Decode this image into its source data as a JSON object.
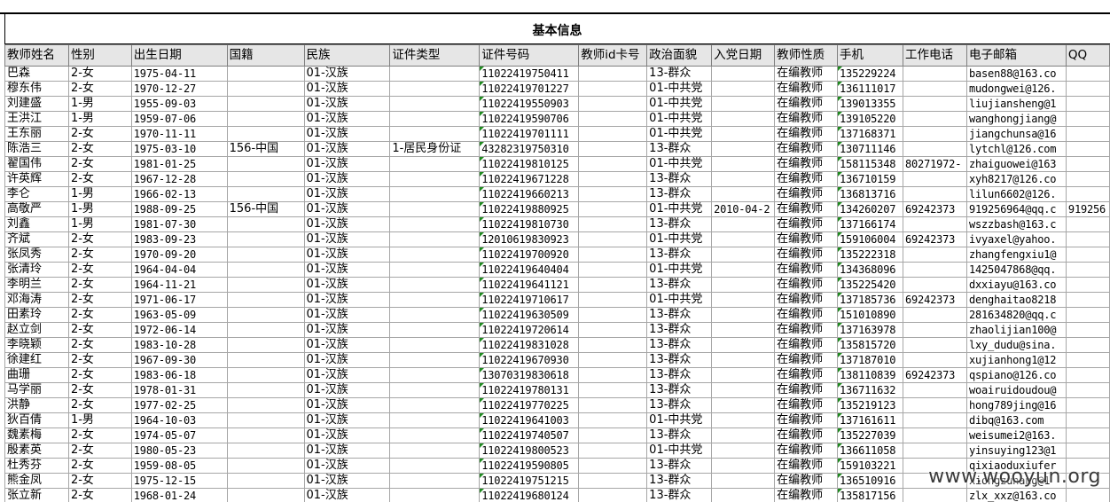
{
  "sheet": {
    "title": "基本信息",
    "headers": [
      "教师姓名",
      "性别",
      "出生日期",
      "国籍",
      "民族",
      "证件类型",
      "证件号码",
      "教师id卡号",
      "政治面貌",
      "入党日期",
      "教师性质",
      "手机",
      "工作电话",
      "电子邮箱",
      "QQ"
    ],
    "rows": [
      [
        "巴森",
        "2-女",
        "1975-04-11",
        "",
        "01-汉族",
        "",
        "11022419750411",
        "",
        "13-群众",
        "",
        "在编教师",
        "135229224",
        "",
        "basen88@163.co",
        ""
      ],
      [
        "穆东伟",
        "2-女",
        "1970-12-27",
        "",
        "01-汉族",
        "",
        "11022419701227",
        "",
        "01-中共党",
        "",
        "在编教师",
        "136111017",
        "",
        "mudongwei@126.",
        ""
      ],
      [
        "刘建盛",
        "1-男",
        "1955-09-03",
        "",
        "01-汉族",
        "",
        "11022419550903",
        "",
        "01-中共党",
        "",
        "在编教师",
        "139013355",
        "",
        "liujiansheng@1",
        ""
      ],
      [
        "王洪江",
        "1-男",
        "1959-07-06",
        "",
        "01-汉族",
        "",
        "11022419590706",
        "",
        "01-中共党",
        "",
        "在编教师",
        "139105220",
        "",
        "wanghongjiang@",
        ""
      ],
      [
        "王东丽",
        "2-女",
        "1970-11-11",
        "",
        "01-汉族",
        "",
        "11022419701111",
        "",
        "01-中共党",
        "",
        "在编教师",
        "137168371",
        "",
        "jiangchunsa@16",
        ""
      ],
      [
        "陈浩三",
        "2-女",
        "1975-03-10",
        "156-中国",
        "01-汉族",
        "1-居民身份证",
        "43282319750310",
        "",
        "13-群众",
        "",
        "在编教师",
        "130711146",
        "",
        "lytchl@126.com",
        ""
      ],
      [
        "翟国伟",
        "2-女",
        "1981-01-25",
        "",
        "01-汉族",
        "",
        "11022419810125",
        "",
        "01-中共党",
        "",
        "在编教师",
        "158115348",
        "80271972-",
        "zhaiguowei@163",
        ""
      ],
      [
        "许英辉",
        "2-女",
        "1967-12-28",
        "",
        "01-汉族",
        "",
        "11022419671228",
        "",
        "13-群众",
        "",
        "在编教师",
        "136710159",
        "",
        "xyh8217@126.co",
        ""
      ],
      [
        "李仑",
        "1-男",
        "1966-02-13",
        "",
        "01-汉族",
        "",
        "11022419660213",
        "",
        "13-群众",
        "",
        "在编教师",
        "136813716",
        "",
        "lilun6602@126.",
        ""
      ],
      [
        "高敬严",
        "1-男",
        "1988-09-25",
        "156-中国",
        "01-汉族",
        "",
        "11022419880925",
        "",
        "01-中共党",
        "2010-04-2",
        "在编教师",
        "134260207",
        "69242373",
        "919256964@qq.c",
        "919256"
      ],
      [
        "刘鑫",
        "1-男",
        "1981-07-30",
        "",
        "01-汉族",
        "",
        "11022419810730",
        "",
        "13-群众",
        "",
        "在编教师",
        "137166174",
        "",
        "wszzbash@163.c",
        ""
      ],
      [
        "齐斌",
        "2-女",
        "1983-09-23",
        "",
        "01-汉族",
        "",
        "12010619830923",
        "",
        "01-中共党",
        "",
        "在编教师",
        "159106004",
        "69242373",
        "ivyaxel@yahoo.",
        ""
      ],
      [
        "张凤秀",
        "2-女",
        "1970-09-20",
        "",
        "01-汉族",
        "",
        "11022419700920",
        "",
        "13-群众",
        "",
        "在编教师",
        "135222318",
        "",
        "zhangfengxiu1@",
        ""
      ],
      [
        "张清玲",
        "2-女",
        "1964-04-04",
        "",
        "01-汉族",
        "",
        "11022419640404",
        "",
        "01-中共党",
        "",
        "在编教师",
        "134368096",
        "",
        "1425047868@qq.",
        ""
      ],
      [
        "李明兰",
        "2-女",
        "1964-11-21",
        "",
        "01-汉族",
        "",
        "11022419641121",
        "",
        "13-群众",
        "",
        "在编教师",
        "135225420",
        "",
        "dxxiayu@163.co",
        ""
      ],
      [
        "邓海涛",
        "2-女",
        "1971-06-17",
        "",
        "01-汉族",
        "",
        "11022419710617",
        "",
        "01-中共党",
        "",
        "在编教师",
        "137185736",
        "69242373",
        "denghaitao8218",
        ""
      ],
      [
        "田素玲",
        "2-女",
        "1963-05-09",
        "",
        "01-汉族",
        "",
        "11022419630509",
        "",
        "13-群众",
        "",
        "在编教师",
        "151010890",
        "",
        "281634820@qq.c",
        ""
      ],
      [
        "赵立剑",
        "2-女",
        "1972-06-14",
        "",
        "01-汉族",
        "",
        "11022419720614",
        "",
        "13-群众",
        "",
        "在编教师",
        "137163978",
        "",
        "zhaolijian100@",
        ""
      ],
      [
        "李晓颖",
        "2-女",
        "1983-10-28",
        "",
        "01-汉族",
        "",
        "11022419831028",
        "",
        "13-群众",
        "",
        "在编教师",
        "135815720",
        "",
        "lxy_dudu@sina.",
        ""
      ],
      [
        "徐建红",
        "2-女",
        "1967-09-30",
        "",
        "01-汉族",
        "",
        "11022419670930",
        "",
        "13-群众",
        "",
        "在编教师",
        "137187010",
        "",
        "xujianhong1@12",
        ""
      ],
      [
        "曲珊",
        "2-女",
        "1983-06-18",
        "",
        "01-汉族",
        "",
        "13070319830618",
        "",
        "13-群众",
        "",
        "在编教师",
        "138110839",
        "69242373",
        "qspiano@126.co",
        ""
      ],
      [
        "马学丽",
        "2-女",
        "1978-01-31",
        "",
        "01-汉族",
        "",
        "11022419780131",
        "",
        "13-群众",
        "",
        "在编教师",
        "136711632",
        "",
        "woairuidoudou@",
        ""
      ],
      [
        "洪静",
        "2-女",
        "1977-02-25",
        "",
        "01-汉族",
        "",
        "11022419770225",
        "",
        "13-群众",
        "",
        "在编教师",
        "135219123",
        "",
        "hong789jing@16",
        ""
      ],
      [
        "狄百倩",
        "1-男",
        "1964-10-03",
        "",
        "01-汉族",
        "",
        "11022419641003",
        "",
        "01-中共党",
        "",
        "在编教师",
        "137161611",
        "",
        "dibq@163.com",
        ""
      ],
      [
        "魏素梅",
        "2-女",
        "1974-05-07",
        "",
        "01-汉族",
        "",
        "11022419740507",
        "",
        "13-群众",
        "",
        "在编教师",
        "135227039",
        "",
        "weisumei2@163.",
        ""
      ],
      [
        "殷素英",
        "2-女",
        "1980-05-23",
        "",
        "01-汉族",
        "",
        "11022419800523",
        "",
        "01-中共党",
        "",
        "在编教师",
        "136611058",
        "",
        "yinsuying123@1",
        ""
      ],
      [
        "杜秀芬",
        "2-女",
        "1959-08-05",
        "",
        "01-汉族",
        "",
        "11022419590805",
        "",
        "13-群众",
        "",
        "在编教师",
        "159103221",
        "",
        "qixiaoduxiufer",
        ""
      ],
      [
        "熊金凤",
        "2-女",
        "1975-12-15",
        "",
        "01-汉族",
        "",
        "11022419751215",
        "",
        "13-群众",
        "",
        "在编教师",
        "136510916",
        "",
        "xiongzunang@1",
        ""
      ],
      [
        "张立新",
        "2-女",
        "1968-01-24",
        "",
        "01-汉族",
        "",
        "11022419680124",
        "",
        "13-群众",
        "",
        "在编教师",
        "135817156",
        "",
        "zlx_xxz@163.co",
        ""
      ]
    ]
  },
  "watermark": {
    "text": "www.wooyun.org"
  },
  "colors": {
    "header_bg": "#e6e6e6",
    "gridline": "#a6a6a6",
    "comment_triangle": "#1f8a1f"
  }
}
